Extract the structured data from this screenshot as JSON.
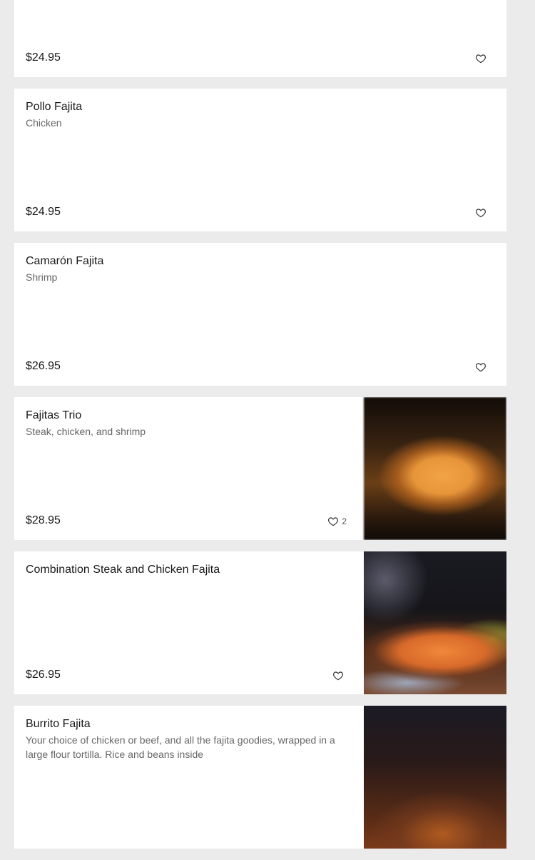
{
  "menu": {
    "items": [
      {
        "name": "",
        "description": "",
        "price": "$24.95",
        "favorites": "",
        "photo": ""
      },
      {
        "name": "Pollo Fajita",
        "description": "Chicken",
        "price": "$24.95",
        "favorites": "",
        "photo": ""
      },
      {
        "name": "Camarón Fajita",
        "description": "Shrimp",
        "price": "$26.95",
        "favorites": "",
        "photo": ""
      },
      {
        "name": "Fajitas Trio",
        "description": "Steak, chicken, and shrimp",
        "price": "$28.95",
        "favorites": "2",
        "photo": "fajitas-trio-photo"
      },
      {
        "name": "Combination Steak and Chicken Fajita",
        "description": "",
        "price": "$26.95",
        "favorites": "",
        "photo": "combination-fajita-photo"
      },
      {
        "name": "Burrito Fajita",
        "description": "Your choice of chicken or beef, and all the fajita goodies, wrapped in a large flour tortilla. Rice and beans inside",
        "price": "",
        "favorites": "",
        "photo": "burrito-fajita-photo"
      }
    ]
  },
  "icons": {
    "favorite": "heart-outline-icon"
  },
  "colors": {
    "page_background": "#ebebeb",
    "card_background": "#ffffff",
    "text_primary": "#1a1a1a",
    "text_secondary": "#666666"
  }
}
